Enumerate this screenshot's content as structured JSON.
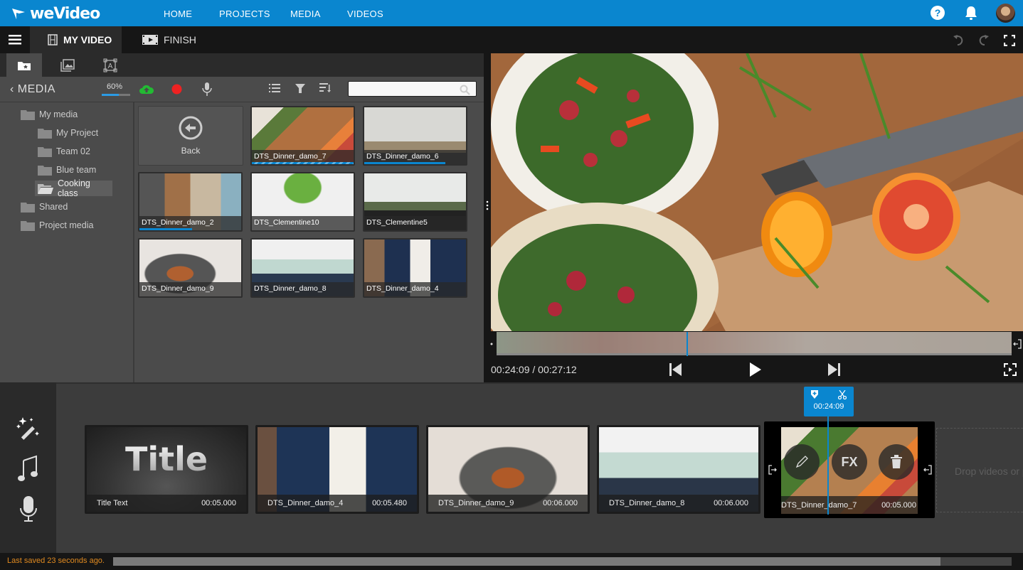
{
  "app": {
    "brand": "weVideo"
  },
  "nav": {
    "links": [
      "HOME",
      "PROJECTS",
      "MEDIA",
      "VIDEOS"
    ],
    "icons": [
      "help-icon",
      "bell-icon",
      "avatar"
    ]
  },
  "editor_tabs": {
    "my_video": "MY VIDEO",
    "finish": "FINISH"
  },
  "media": {
    "title": "MEDIA",
    "upload_progress": "60%",
    "upload_progress_value": 0.6,
    "search_placeholder": "",
    "folders": [
      {
        "label": "My media",
        "level": 0
      },
      {
        "label": "My Project",
        "level": 1
      },
      {
        "label": "Team 02",
        "level": 1
      },
      {
        "label": "Blue team",
        "level": 1
      },
      {
        "label": "Cooking class",
        "level": 1,
        "selected": true
      },
      {
        "label": "Shared",
        "level": 0
      },
      {
        "label": "Project media",
        "level": 0
      }
    ],
    "back_label": "Back",
    "items": [
      {
        "name": "DTS_Dinner_damo_7",
        "progress": 1.0,
        "state": "uploading"
      },
      {
        "name": "DTS_Dinner_damo_6",
        "progress": 0.8
      },
      {
        "name": "DTS_Dinner_damo_2",
        "progress": 0.52
      },
      {
        "name": "DTS_Clementine10"
      },
      {
        "name": "DTS_Clementine5"
      },
      {
        "name": "DTS_Dinner_damo_9"
      },
      {
        "name": "DTS_Dinner_damo_8"
      },
      {
        "name": "DTS_Dinner_damo_4"
      }
    ]
  },
  "preview": {
    "timecode": "00:24:09 / 00:27:12",
    "scrub_position": 0.37
  },
  "timeline": {
    "clips": [
      {
        "title": "Title Text",
        "duration": "00:05.000",
        "overlay": "Title"
      },
      {
        "title": "DTS_Dinner_damo_4",
        "duration": "00:05.480"
      },
      {
        "title": "DTS_Dinner_damo_9",
        "duration": "00:06.000"
      },
      {
        "title": "DTS_Dinner_damo_8",
        "duration": "00:06.000"
      },
      {
        "title": "DTS_Dinner_damo_7",
        "duration": "00:05.000",
        "selected": true
      }
    ],
    "fx_label": "FX",
    "playhead_time": "00:24:09",
    "drop_zone": "Drop videos or photos here"
  },
  "status": {
    "last_saved": "Last saved 23 seconds ago.",
    "scroll_position": 0.92
  },
  "colors": {
    "brand": "#0a86cf",
    "status_text": "#e08a20",
    "record": "#ee2222",
    "upload": "#22bb33"
  }
}
